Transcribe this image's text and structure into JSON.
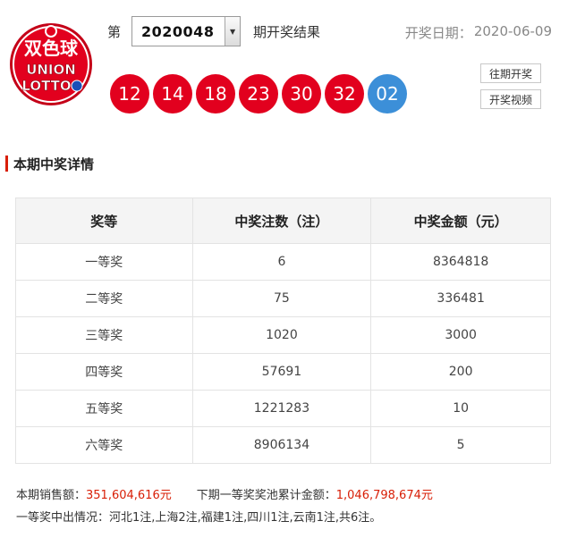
{
  "logo": {
    "top_text": "双色球",
    "mid_text": "UNION",
    "bottom_text": "LOTTO",
    "colors": {
      "bg": "#e2001e",
      "ring": "#ffffff",
      "ball_blue": "#1a4fb8"
    }
  },
  "header": {
    "issue_prefix": "第",
    "issue_value": "2020048",
    "issue_suffix": "期开奖结果",
    "date_label": "开奖日期：",
    "date_value": "2020-06-09"
  },
  "balls": {
    "red": [
      "12",
      "14",
      "18",
      "23",
      "30",
      "32"
    ],
    "blue": [
      "02"
    ],
    "colors": {
      "red": "#e2001e",
      "blue": "#3c8fd8"
    }
  },
  "side_buttons": {
    "history": "往期开奖",
    "video": "开奖视频"
  },
  "section": {
    "title": "本期中奖详情"
  },
  "table": {
    "headers": [
      "奖等",
      "中奖注数（注）",
      "中奖金额（元）"
    ],
    "rows": [
      [
        "一等奖",
        "6",
        "8364818"
      ],
      [
        "二等奖",
        "75",
        "336481"
      ],
      [
        "三等奖",
        "1020",
        "3000"
      ],
      [
        "四等奖",
        "57691",
        "200"
      ],
      [
        "五等奖",
        "1221283",
        "10"
      ],
      [
        "六等奖",
        "8906134",
        "5"
      ]
    ]
  },
  "footer": {
    "sales_label": "本期销售额：",
    "sales_value": "351,604,616元",
    "pool_label": "下期一等奖奖池累计金额：",
    "pool_value": "1,046,798,674元",
    "winners_text": "一等奖中出情况：河北1注,上海2注,福建1注,四川1注,云南1注,共6注。"
  }
}
